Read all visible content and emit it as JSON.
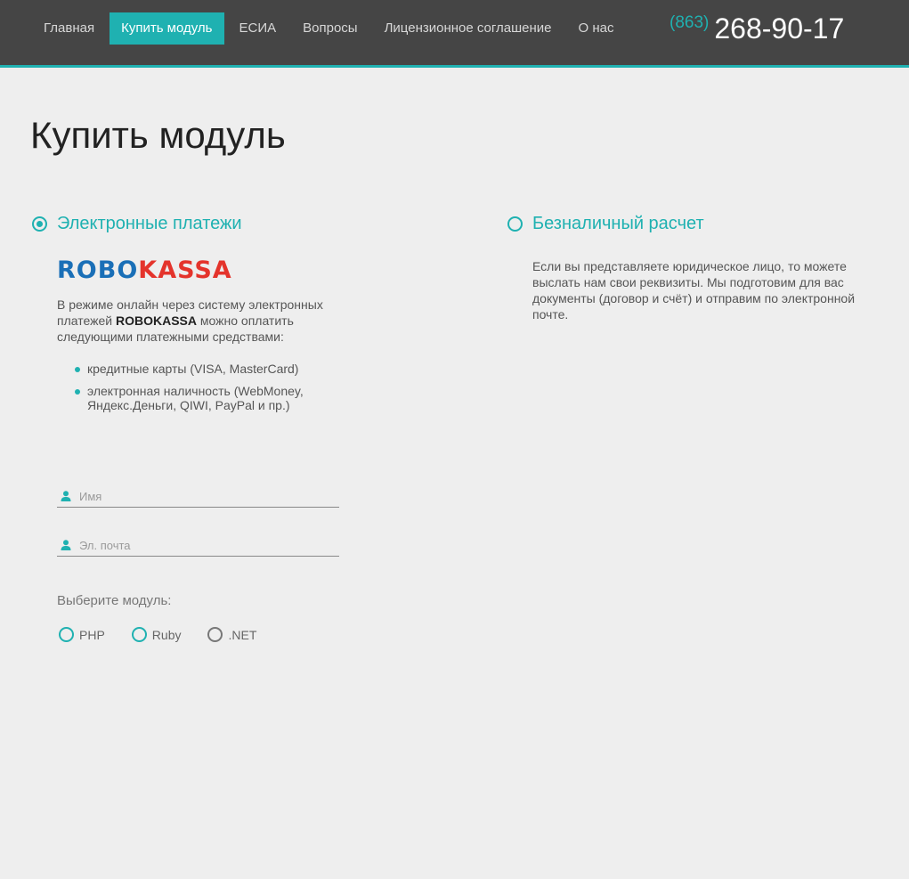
{
  "nav": {
    "items": [
      {
        "label": "Главная",
        "active": false
      },
      {
        "label": "Купить модуль",
        "active": true
      },
      {
        "label": "ЕСИА",
        "active": false
      },
      {
        "label": "Вопросы",
        "active": false
      },
      {
        "label": "Лицензионное соглашение",
        "active": false
      },
      {
        "label": "О нас",
        "active": false
      }
    ]
  },
  "phone": {
    "code": "(863)",
    "number": "268-90-17"
  },
  "page_title": "Купить модуль",
  "electronic": {
    "heading": "Электронные платежи",
    "logo_part1": "ROBO",
    "logo_part2": "KASSA",
    "intro_before": "В режиме онлайн через систему электронных платежей ",
    "intro_brand": "ROBOKASSA",
    "intro_after": " можно оплатить следующими платежными средствами:",
    "bullets": [
      "кредитные карты (VISA, MasterCard)",
      "электронная наличность (WebMoney, Яндекс.Деньги, QIWI, PayPal и пр.)"
    ],
    "name_placeholder": "Имя",
    "email_placeholder": "Эл. почта",
    "module_label": "Выберите модуль:",
    "modules": [
      "PHP",
      "Ruby",
      ".NET"
    ]
  },
  "cashless": {
    "heading": "Безналичный расчет",
    "text": "Если вы представляете юридическое лицо, то можете выслать нам свои реквизиты. Мы подготовим для вас документы (договор и счёт) и отправим по электронной почте."
  },
  "colors": {
    "accent": "#1fb1b1",
    "header_bg": "#454545",
    "page_bg": "#eeeeee",
    "logo_blue": "#1a6fb7",
    "logo_red": "#e4342c"
  },
  "icons": [
    "user-icon"
  ]
}
